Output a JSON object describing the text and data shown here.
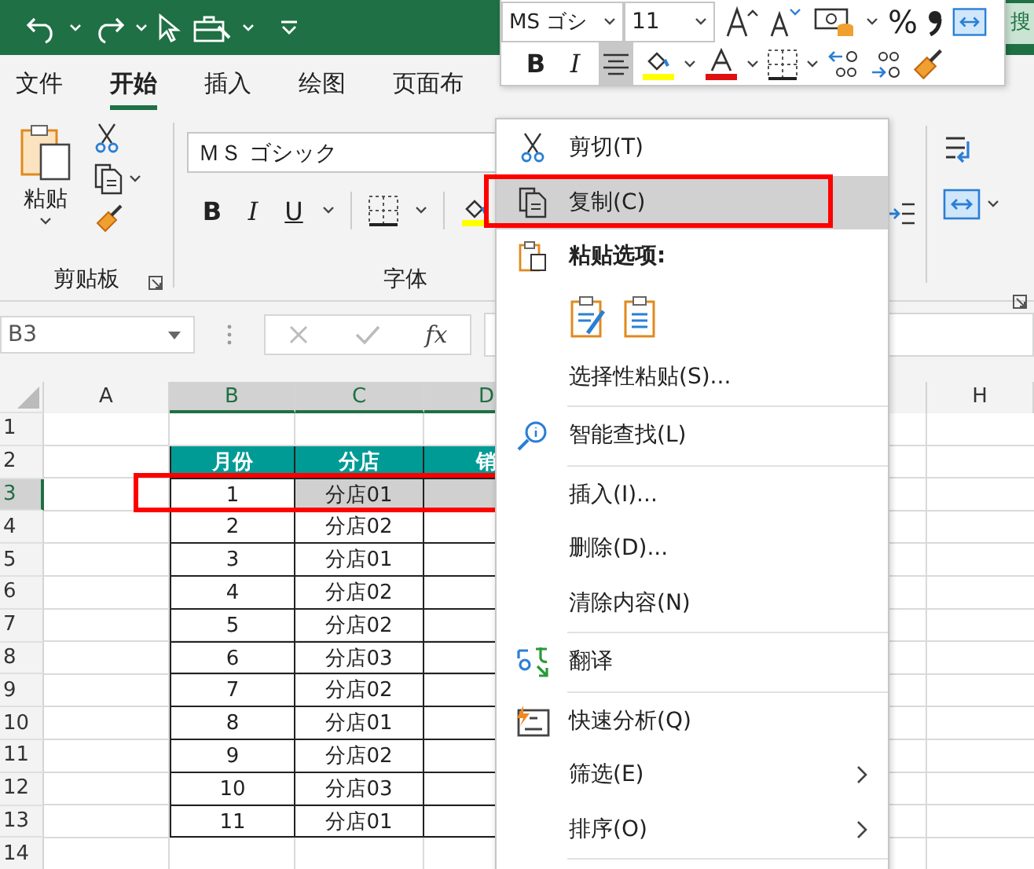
{
  "search_box": "搜",
  "tabs": [
    {
      "label": "文件",
      "selected": false
    },
    {
      "label": "开始",
      "selected": true
    },
    {
      "label": "插入",
      "selected": false
    },
    {
      "label": "绘图",
      "selected": false
    },
    {
      "label": "页面布",
      "selected": false
    }
  ],
  "ribbon": {
    "clipboard": {
      "paste_label": "粘贴",
      "group_label": "剪贴板"
    },
    "font": {
      "font_name": "ＭＳ ゴシック",
      "format_buttons": [
        "B",
        "I",
        "U"
      ],
      "group_label": "字体"
    }
  },
  "formula_bar": {
    "name_box": "B3",
    "function_label": "fx"
  },
  "sheet": {
    "columns": [
      {
        "label": "A",
        "selected": false
      },
      {
        "label": "B",
        "selected": true
      },
      {
        "label": "C",
        "selected": true
      },
      {
        "label": "D",
        "selected": true
      },
      {
        "label": "H",
        "selected": false
      }
    ],
    "rows": [
      {
        "num": "1",
        "kind": "empty",
        "selected": false
      },
      {
        "num": "2",
        "kind": "header",
        "selected": false,
        "cells": [
          {
            "text": "月份"
          },
          {
            "text": "分店"
          },
          {
            "text": "销"
          }
        ]
      },
      {
        "num": "3",
        "kind": "data",
        "selected": true,
        "cells": [
          {
            "text": "1",
            "selected": false
          },
          {
            "text": "分店01",
            "selected": true
          },
          {
            "text": "",
            "selected": true
          }
        ]
      },
      {
        "num": "4",
        "kind": "data",
        "selected": false,
        "cells": [
          {
            "text": "2",
            "selected": false
          },
          {
            "text": "分店02",
            "selected": false
          }
        ]
      },
      {
        "num": "5",
        "kind": "data",
        "selected": false,
        "cells": [
          {
            "text": "3",
            "selected": false
          },
          {
            "text": "分店01",
            "selected": false
          }
        ]
      },
      {
        "num": "6",
        "kind": "data",
        "selected": false,
        "cells": [
          {
            "text": "4",
            "selected": false
          },
          {
            "text": "分店02",
            "selected": false
          }
        ]
      },
      {
        "num": "7",
        "kind": "data",
        "selected": false,
        "cells": [
          {
            "text": "5",
            "selected": false
          },
          {
            "text": "分店02",
            "selected": false
          }
        ]
      },
      {
        "num": "8",
        "kind": "data",
        "selected": false,
        "cells": [
          {
            "text": "6",
            "selected": false
          },
          {
            "text": "分店03",
            "selected": false
          }
        ]
      },
      {
        "num": "9",
        "kind": "data",
        "selected": false,
        "cells": [
          {
            "text": "7",
            "selected": false
          },
          {
            "text": "分店02",
            "selected": false
          }
        ]
      },
      {
        "num": "10",
        "kind": "data",
        "selected": false,
        "cells": [
          {
            "text": "8",
            "selected": false
          },
          {
            "text": "分店01",
            "selected": false
          }
        ]
      },
      {
        "num": "11",
        "kind": "data",
        "selected": false,
        "cells": [
          {
            "text": "9",
            "selected": false
          },
          {
            "text": "分店02",
            "selected": false
          }
        ]
      },
      {
        "num": "12",
        "kind": "data",
        "selected": false,
        "cells": [
          {
            "text": "10",
            "selected": false
          },
          {
            "text": "分店03",
            "selected": false
          }
        ]
      },
      {
        "num": "13",
        "kind": "data",
        "selected": false,
        "cells": [
          {
            "text": "11",
            "selected": false
          },
          {
            "text": "分店01",
            "selected": false
          }
        ]
      },
      {
        "num": "14",
        "kind": "empty",
        "selected": false
      }
    ]
  },
  "mini_toolbar": {
    "font_name": "MS ゴシ",
    "font_size": "11",
    "percent": "%",
    "bold": "B",
    "italic": "I",
    "center_align_selected": true
  },
  "context_menu": [
    {
      "kind": "cut",
      "label": "剪切(T)",
      "selected": false
    },
    {
      "kind": "copy",
      "label": "复制(C)",
      "selected": true
    },
    {
      "kind": "pasteheader",
      "label": "粘贴选项:",
      "selected": false
    },
    {
      "kind": "pasteicons"
    },
    {
      "kind": "plain",
      "label": "选择性粘贴(S)...",
      "selected": false
    },
    {
      "kind": "separator"
    },
    {
      "kind": "lookup",
      "label": "智能查找(L)",
      "selected": false
    },
    {
      "kind": "separator"
    },
    {
      "kind": "plain",
      "label": "插入(I)...",
      "selected": false
    },
    {
      "kind": "plain",
      "label": "删除(D)...",
      "selected": false
    },
    {
      "kind": "plain",
      "label": "清除内容(N)",
      "selected": false
    },
    {
      "kind": "separator"
    },
    {
      "kind": "translate",
      "label": "翻译",
      "selected": false
    },
    {
      "kind": "separator"
    },
    {
      "kind": "analysis",
      "label": "快速分析(Q)",
      "selected": false
    },
    {
      "kind": "submenu",
      "label": "筛选(E)",
      "selected": false
    },
    {
      "kind": "submenu",
      "label": "排序(O)",
      "selected": false
    },
    {
      "kind": "separator"
    }
  ]
}
